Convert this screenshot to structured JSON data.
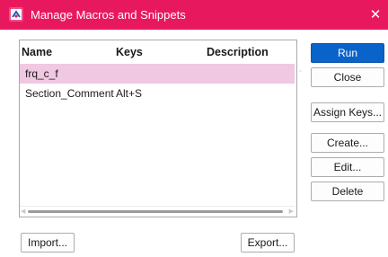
{
  "window": {
    "title": "Manage Macros and Snippets",
    "close_glyph": "✕",
    "app_icon": "macro-app-icon",
    "titlebar_color": "#e8185f"
  },
  "list": {
    "columns": [
      "Name",
      "Keys",
      "Description"
    ],
    "rows": [
      {
        "name": "frq_c_f",
        "keys": "",
        "description": "",
        "selected": true
      },
      {
        "name": "Section_Comment",
        "keys": "Alt+S",
        "description": "",
        "selected": false
      }
    ],
    "selection_color": "#f0c8e2",
    "scroll_left_glyph": "◀",
    "scroll_right_glyph": "▶"
  },
  "buttons": {
    "run": "Run",
    "close": "Close",
    "assign_keys": "Assign Keys...",
    "create": "Create...",
    "edit": "Edit...",
    "delete": "Delete",
    "import": "Import...",
    "export": "Export..."
  },
  "colors": {
    "accent": "#0a63c9"
  }
}
